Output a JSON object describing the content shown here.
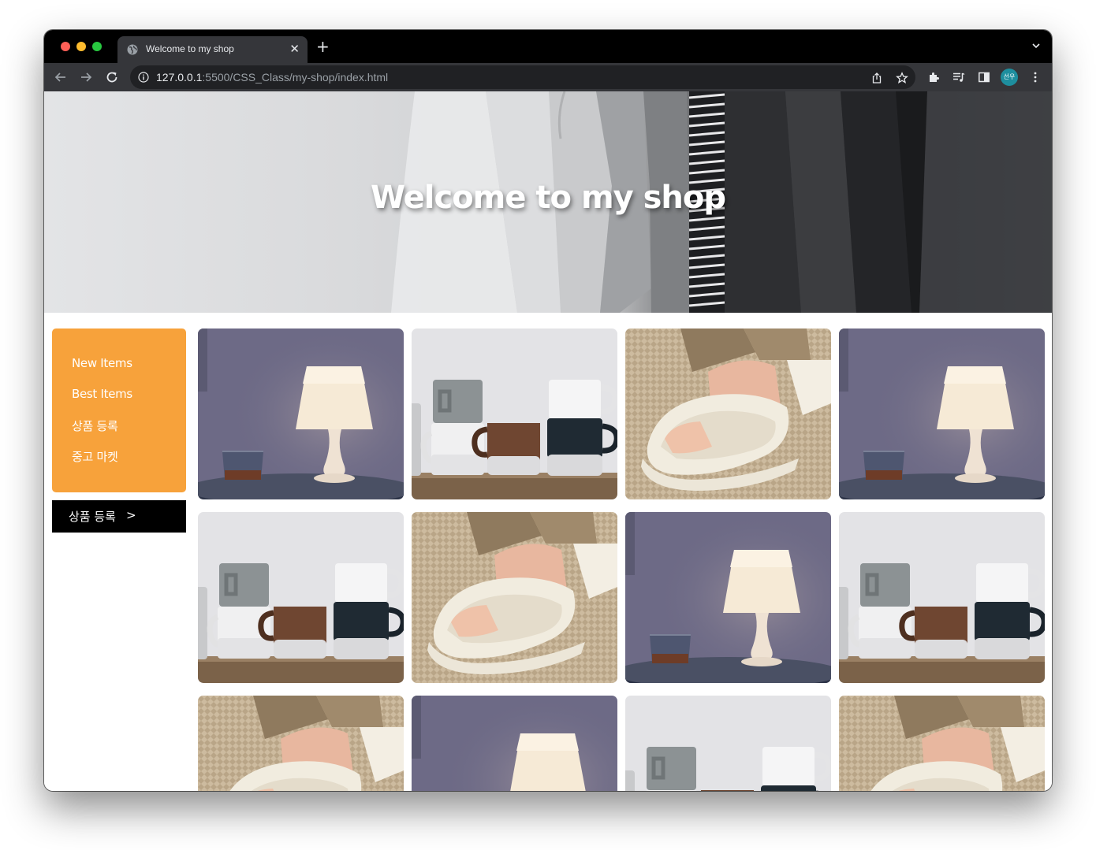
{
  "browser": {
    "tab_title": "Welcome to my shop",
    "url_host": "127.0.0.1",
    "url_path": ":5500/CSS_Class/my-shop/index.html",
    "profile_initials": "선우",
    "new_tab_symbol": "+",
    "close_symbol": "✕"
  },
  "hero": {
    "title": "Welcome to my shop"
  },
  "sidebar": {
    "items": [
      {
        "label": "New Items"
      },
      {
        "label": "Best Items"
      },
      {
        "label": "상품 등록"
      },
      {
        "label": "중고 마켓"
      }
    ],
    "register_button": {
      "label": "상품 등록",
      "arrow": ">"
    }
  },
  "products": [
    {
      "image": "lamp"
    },
    {
      "image": "mugs"
    },
    {
      "image": "slippers"
    },
    {
      "image": "lamp"
    },
    {
      "image": "mugs"
    },
    {
      "image": "slippers"
    },
    {
      "image": "lamp"
    },
    {
      "image": "mugs"
    },
    {
      "image": "slippers"
    },
    {
      "image": "lamp"
    },
    {
      "image": "mugs"
    },
    {
      "image": "slippers"
    }
  ],
  "colors": {
    "sidebar_bg": "#f7a23b",
    "button_bg": "#000000"
  }
}
